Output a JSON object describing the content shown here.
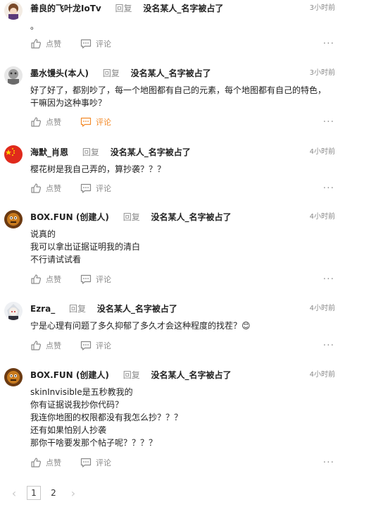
{
  "comments": [
    {
      "author": "善良的飞叶龙IoTv",
      "reply_word": "回复",
      "reply_target": "没名某人_名字被占了",
      "time": "3小时前",
      "content": "。",
      "like_label": "点赞",
      "comment_label": "评论"
    },
    {
      "author": "墨水馒头(本人)",
      "reply_word": "回复",
      "reply_target": "没名某人_名字被占了",
      "time": "3小时前",
      "content": "好了好了，都别吵了，每一个地图都有自己的元素，每个地图都有自己的特色，干嘛因为这种事吵？",
      "like_label": "点赞",
      "comment_label": "评论"
    },
    {
      "author": "海默_肖恩",
      "reply_word": "回复",
      "reply_target": "没名某人_名字被占了",
      "time": "4小时前",
      "content": "樱花树是我自己弄的，算抄袭？？？",
      "like_label": "点赞",
      "comment_label": "评论"
    },
    {
      "author": "BOX.FUN (创建人)",
      "reply_word": "回复",
      "reply_target": "没名某人_名字被占了",
      "time": "4小时前",
      "content": "说真的\n我可以拿出证据证明我的清白\n不行请试试看",
      "like_label": "点赞",
      "comment_label": "评论"
    },
    {
      "author": "Ezra_",
      "reply_word": "回复",
      "reply_target": "没名某人_名字被占了",
      "time": "4小时前",
      "content": "宁是心理有问题了多久抑郁了多久才会这种程度的找茬？😊",
      "like_label": "点赞",
      "comment_label": "评论"
    },
    {
      "author": "BOX.FUN (创建人)",
      "reply_word": "回复",
      "reply_target": "没名某人_名字被占了",
      "time": "4小时前",
      "content": "skinInvisible是五秒教我的\n你有证据说我抄你代码？\n我连你地图的权限都没有我怎么抄？？？\n还有如果怕别人抄袭\n那你干啥要发那个帖子呢？？？？",
      "like_label": "点赞",
      "comment_label": "评论"
    }
  ],
  "more_label": "···",
  "pagination": {
    "prev": "‹",
    "pages": [
      "1",
      "2"
    ],
    "current": "1",
    "next": "›"
  },
  "colors": {
    "muted": "#8a8a8a",
    "active_comment": "#f38b2a",
    "text": "#222222"
  }
}
